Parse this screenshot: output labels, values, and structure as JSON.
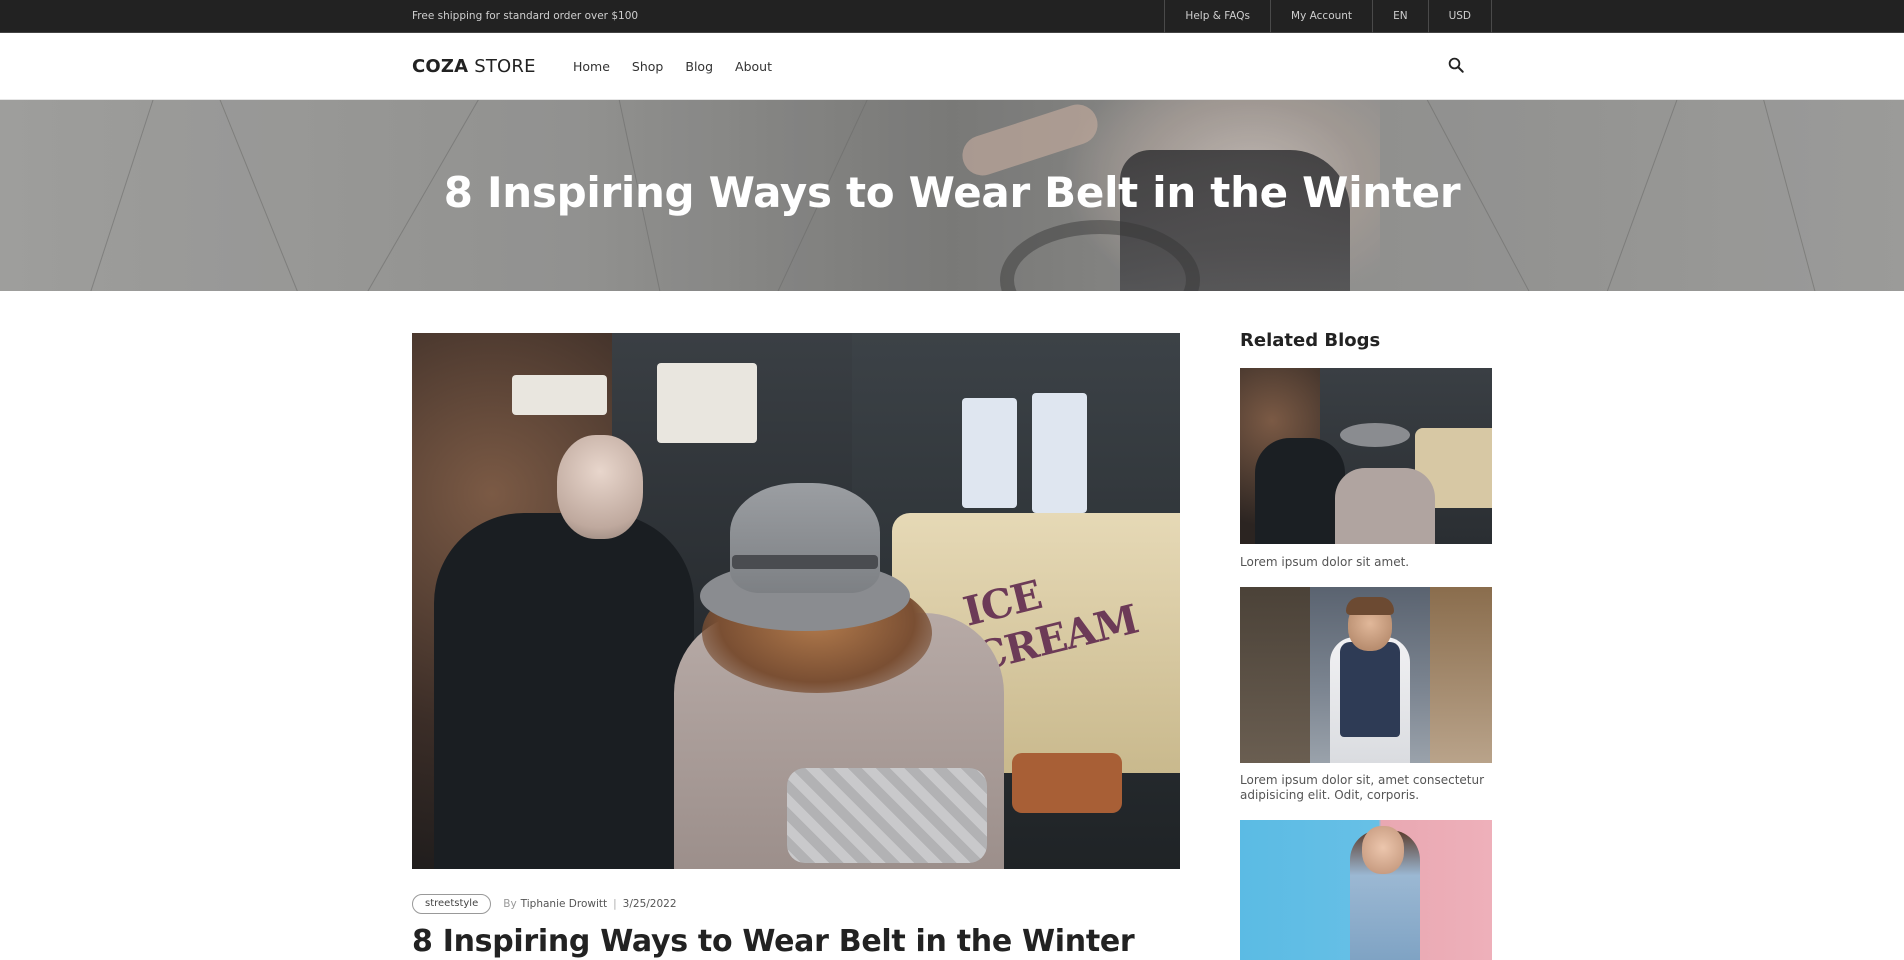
{
  "topbar": {
    "promo": "Free shipping for standard order over $100",
    "links": [
      "Help & FAQs",
      "My Account",
      "EN",
      "USD"
    ]
  },
  "header": {
    "logo_bold": "COZA",
    "logo_rest": " STORE",
    "nav": [
      "Home",
      "Shop",
      "Blog",
      "About"
    ],
    "search_icon": "search-icon"
  },
  "hero": {
    "title": "8 Inspiring Ways to Wear Belt in the Winter"
  },
  "post": {
    "tag": "streetstyle",
    "by": "By",
    "author": "Tiphanie Drowitt",
    "separator": "|",
    "date": "3/25/2022",
    "title": "8 Inspiring Ways to Wear Belt in the Winter"
  },
  "sidebar": {
    "title": "Related Blogs",
    "items": [
      {
        "text": "Lorem ipsum dolor sit amet."
      },
      {
        "text": "Lorem ipsum dolor sit, amet consectetur adipisicing elit. Odit, corporis."
      },
      {
        "text": ""
      }
    ]
  },
  "colors": {
    "topbar_bg": "#222222",
    "text_dark": "#222222",
    "hero_text": "#ffffff"
  }
}
